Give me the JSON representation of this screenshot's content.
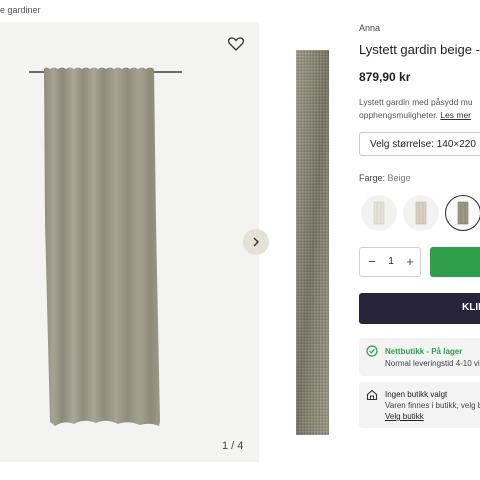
{
  "breadcrumb": {
    "text": "e gardiner"
  },
  "gallery": {
    "counter": "1 / 4",
    "favorite_icon": "heart-icon",
    "next_icon": "chevron-right-icon"
  },
  "product": {
    "brand": "Anna",
    "title": "Lystett gardin beige -",
    "price": "879,90 kr",
    "description_line1": "Lystett gardin med påsydd mu",
    "description_line2": "opphengsmuligheter.",
    "read_more": "Les mer",
    "size_select": "Velg størrelse: 140×220",
    "color_label": "Farge:",
    "color_value": "Beige",
    "swatches": [
      {
        "name": "white",
        "color": "#e6e2d8"
      },
      {
        "name": "light-beige",
        "color": "#d8d0c2"
      },
      {
        "name": "beige",
        "color": "#9d9986",
        "selected": true
      }
    ],
    "quantity": "1",
    "cta_label": "KLIK",
    "accent_green": "#2f9e4a",
    "cta_dark": "#26233a"
  },
  "stock": {
    "title": "Nettbutikk - På lager",
    "delivery": "Normal leveringstid 4-10 vi"
  },
  "store": {
    "title": "Ingen butikk valgt",
    "info": "Varen finnes i butikk, velg b",
    "link": "Velg butikk"
  }
}
